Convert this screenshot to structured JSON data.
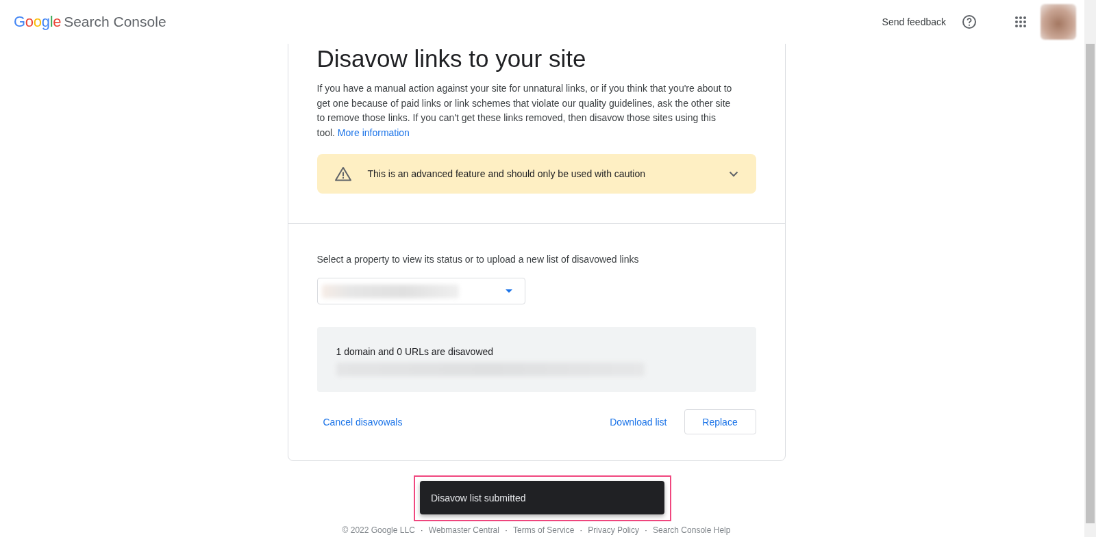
{
  "header": {
    "logo": "Google",
    "product": "Search Console",
    "send_feedback": "Send feedback"
  },
  "page": {
    "title": "Disavow links to your site",
    "intro": "If you have a manual action against your site for unnatural links, or if you think that you're about to get one because of paid links or link schemes that violate our quality guidelines, ask the other site to remove those links. If you can't get these links removed, then disavow those sites using this tool.",
    "intro_link": "More information",
    "warning": {
      "text": "This is an advanced feature and should only be used with caution",
      "expanded": false
    },
    "property_prompt": "Select a property to view its status or to upload a new list of disavowed links",
    "status": {
      "summary": "1 domain and 0 URLs are disavowed"
    },
    "actions_start": [
      {
        "kind": "link",
        "label": "Cancel disavowals"
      }
    ],
    "actions_end": [
      {
        "kind": "link",
        "label": "Download list"
      },
      {
        "kind": "outlined",
        "label": "Replace"
      }
    ]
  },
  "footer": {
    "separator": "·",
    "items": [
      "© 2022 Google LLC",
      "Webmaster Central",
      "Terms of Service",
      "Privacy Policy",
      "Search Console Help"
    ]
  },
  "snackbar": {
    "message": "Disavow list submitted",
    "highlighted": true
  }
}
